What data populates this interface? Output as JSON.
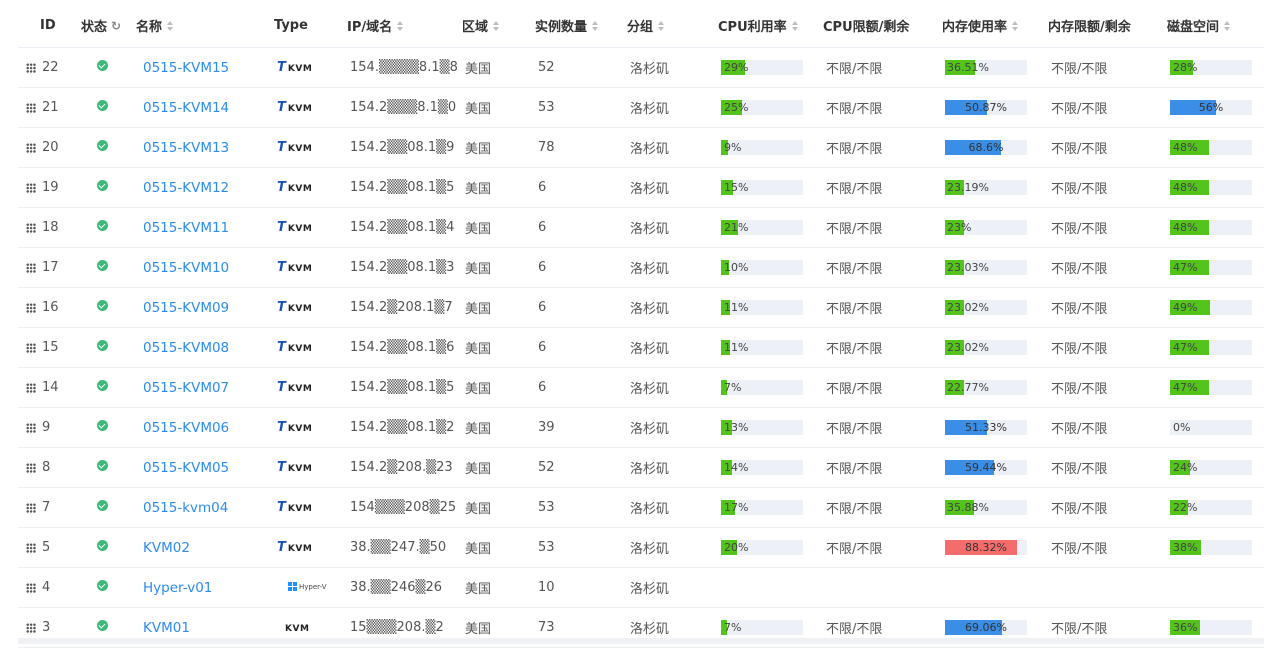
{
  "colors": {
    "green": "#52c41a",
    "blue": "#3a8ee6",
    "red": "#f56c6c",
    "link": "#2d8cf0",
    "status_ok": "#3fb978"
  },
  "columns": {
    "id": "ID",
    "status": "状态",
    "name": "名称",
    "type": "Type",
    "ip": "IP/域名",
    "region": "区域",
    "instances": "实例数量",
    "group": "分组",
    "cpu": "CPU利用率",
    "cpu_limit": "CPU限额/剩余",
    "mem": "内存使用率",
    "mem_limit": "内存限额/剩余",
    "disk": "磁盘空间"
  },
  "rows": [
    {
      "id": "22",
      "name": "0515-KVM15",
      "type": "KVM",
      "ip": "154.▒▒▒▒8.1▒8",
      "region": "美国",
      "instances": "52",
      "group": "洛杉矶",
      "cpu": "29%",
      "cpu_v": 29,
      "cpu_c": "green",
      "cpu_limit": "不限/不限",
      "mem": "36.51%",
      "mem_v": 36.51,
      "mem_c": "green",
      "mem_limit": "不限/不限",
      "disk": "28%",
      "disk_v": 28,
      "disk_c": "green"
    },
    {
      "id": "21",
      "name": "0515-KVM14",
      "type": "KVM",
      "ip": "154.2▒▒▒8.1▒0",
      "region": "美国",
      "instances": "53",
      "group": "洛杉矶",
      "cpu": "25%",
      "cpu_v": 25,
      "cpu_c": "green",
      "cpu_limit": "不限/不限",
      "mem": "50.87%",
      "mem_v": 50.87,
      "mem_c": "blue",
      "mem_limit": "不限/不限",
      "disk": "56%",
      "disk_v": 56,
      "disk_c": "blue"
    },
    {
      "id": "20",
      "name": "0515-KVM13",
      "type": "KVM",
      "ip": "154.2▒▒08.1▒9",
      "region": "美国",
      "instances": "78",
      "group": "洛杉矶",
      "cpu": "9%",
      "cpu_v": 9,
      "cpu_c": "green",
      "cpu_limit": "不限/不限",
      "mem": "68.6%",
      "mem_v": 68.6,
      "mem_c": "blue",
      "mem_limit": "不限/不限",
      "disk": "48%",
      "disk_v": 48,
      "disk_c": "green"
    },
    {
      "id": "19",
      "name": "0515-KVM12",
      "type": "KVM",
      "ip": "154.2▒▒08.1▒5",
      "region": "美国",
      "instances": "6",
      "group": "洛杉矶",
      "cpu": "15%",
      "cpu_v": 15,
      "cpu_c": "green",
      "cpu_limit": "不限/不限",
      "mem": "23.19%",
      "mem_v": 23.19,
      "mem_c": "green",
      "mem_limit": "不限/不限",
      "disk": "48%",
      "disk_v": 48,
      "disk_c": "green"
    },
    {
      "id": "18",
      "name": "0515-KVM11",
      "type": "KVM",
      "ip": "154.2▒▒08.1▒4",
      "region": "美国",
      "instances": "6",
      "group": "洛杉矶",
      "cpu": "21%",
      "cpu_v": 21,
      "cpu_c": "green",
      "cpu_limit": "不限/不限",
      "mem": "23%",
      "mem_v": 23,
      "mem_c": "green",
      "mem_limit": "不限/不限",
      "disk": "48%",
      "disk_v": 48,
      "disk_c": "green"
    },
    {
      "id": "17",
      "name": "0515-KVM10",
      "type": "KVM",
      "ip": "154.2▒▒08.1▒3",
      "region": "美国",
      "instances": "6",
      "group": "洛杉矶",
      "cpu": "10%",
      "cpu_v": 10,
      "cpu_c": "green",
      "cpu_limit": "不限/不限",
      "mem": "23.03%",
      "mem_v": 23.03,
      "mem_c": "green",
      "mem_limit": "不限/不限",
      "disk": "47%",
      "disk_v": 47,
      "disk_c": "green"
    },
    {
      "id": "16",
      "name": "0515-KVM09",
      "type": "KVM",
      "ip": "154.2▒208.1▒7",
      "region": "美国",
      "instances": "6",
      "group": "洛杉矶",
      "cpu": "11%",
      "cpu_v": 11,
      "cpu_c": "green",
      "cpu_limit": "不限/不限",
      "mem": "23.02%",
      "mem_v": 23.02,
      "mem_c": "green",
      "mem_limit": "不限/不限",
      "disk": "49%",
      "disk_v": 49,
      "disk_c": "green"
    },
    {
      "id": "15",
      "name": "0515-KVM08",
      "type": "KVM",
      "ip": "154.2▒▒08.1▒6",
      "region": "美国",
      "instances": "6",
      "group": "洛杉矶",
      "cpu": "11%",
      "cpu_v": 11,
      "cpu_c": "green",
      "cpu_limit": "不限/不限",
      "mem": "23.02%",
      "mem_v": 23.02,
      "mem_c": "green",
      "mem_limit": "不限/不限",
      "disk": "47%",
      "disk_v": 47,
      "disk_c": "green"
    },
    {
      "id": "14",
      "name": "0515-KVM07",
      "type": "KVM",
      "ip": "154.2▒▒08.1▒5",
      "region": "美国",
      "instances": "6",
      "group": "洛杉矶",
      "cpu": "7%",
      "cpu_v": 7,
      "cpu_c": "green",
      "cpu_limit": "不限/不限",
      "mem": "22.77%",
      "mem_v": 22.77,
      "mem_c": "green",
      "mem_limit": "不限/不限",
      "disk": "47%",
      "disk_v": 47,
      "disk_c": "green"
    },
    {
      "id": "9",
      "name": "0515-KVM06",
      "type": "KVM",
      "ip": "154.2▒▒08.1▒2",
      "region": "美国",
      "instances": "39",
      "group": "洛杉矶",
      "cpu": "13%",
      "cpu_v": 13,
      "cpu_c": "green",
      "cpu_limit": "不限/不限",
      "mem": "51.33%",
      "mem_v": 51.33,
      "mem_c": "blue",
      "mem_limit": "不限/不限",
      "disk": "0%",
      "disk_v": 0,
      "disk_c": "green"
    },
    {
      "id": "8",
      "name": "0515-KVM05",
      "type": "KVM",
      "ip": "154.2▒208.▒23",
      "region": "美国",
      "instances": "52",
      "group": "洛杉矶",
      "cpu": "14%",
      "cpu_v": 14,
      "cpu_c": "green",
      "cpu_limit": "不限/不限",
      "mem": "59.44%",
      "mem_v": 59.44,
      "mem_c": "blue",
      "mem_limit": "不限/不限",
      "disk": "24%",
      "disk_v": 24,
      "disk_c": "green"
    },
    {
      "id": "7",
      "name": "0515-kvm04",
      "type": "KVM",
      "ip": "154▒▒▒208▒25",
      "region": "美国",
      "instances": "53",
      "group": "洛杉矶",
      "cpu": "17%",
      "cpu_v": 17,
      "cpu_c": "green",
      "cpu_limit": "不限/不限",
      "mem": "35.88%",
      "mem_v": 35.88,
      "mem_c": "green",
      "mem_limit": "不限/不限",
      "disk": "22%",
      "disk_v": 22,
      "disk_c": "green"
    },
    {
      "id": "5",
      "name": "KVM02",
      "type": "KVM",
      "ip": "38.▒▒247.▒50",
      "region": "美国",
      "instances": "53",
      "group": "洛杉矶",
      "cpu": "20%",
      "cpu_v": 20,
      "cpu_c": "green",
      "cpu_limit": "不限/不限",
      "mem": "88.32%",
      "mem_v": 88.32,
      "mem_c": "red",
      "mem_limit": "不限/不限",
      "disk": "38%",
      "disk_v": 38,
      "disk_c": "green"
    },
    {
      "id": "4",
      "name": "Hyper-v01",
      "type": "Hyper-V",
      "ip": "38.▒▒246▒26",
      "region": "美国",
      "instances": "10",
      "group": "洛杉矶",
      "cpu": "",
      "cpu_limit": "",
      "mem": "",
      "mem_limit": "",
      "disk": ""
    },
    {
      "id": "3",
      "name": "KVM01",
      "type": "KVM-nologo",
      "ip": "15▒▒▒208.▒2",
      "region": "美国",
      "instances": "73",
      "group": "洛杉矶",
      "cpu": "7%",
      "cpu_v": 7,
      "cpu_c": "green",
      "cpu_limit": "不限/不限",
      "mem": "69.06%",
      "mem_v": 69.06,
      "mem_c": "blue",
      "mem_limit": "不限/不限",
      "disk": "36%",
      "disk_v": 36,
      "disk_c": "green"
    }
  ],
  "logos": {
    "tk_t": "T",
    "tk_kvm": "KVM",
    "hyperv": "Hyper-V"
  }
}
